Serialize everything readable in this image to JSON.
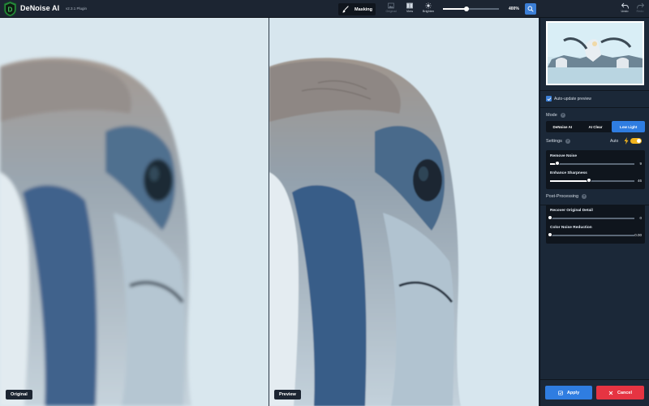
{
  "app": {
    "title": "DeNoise AI",
    "version": "v2.3.1 Plugin"
  },
  "toolbar": {
    "masking_label": "Masking",
    "tools": [
      {
        "label": "Original",
        "icon": "image-icon",
        "enabled": false
      },
      {
        "label": "View",
        "icon": "split-view-icon",
        "enabled": true
      },
      {
        "label": "Brighten",
        "icon": "sun-icon",
        "enabled": true
      }
    ],
    "zoom_value": "400%",
    "zoom_level": 0.4,
    "undo_label": "Undo",
    "redo_label": "Redo"
  },
  "panes": {
    "original_label": "Original",
    "preview_label": "Preview"
  },
  "sidebar": {
    "auto_update": {
      "label": "Auto-update preview",
      "checked": true
    },
    "mode": {
      "title": "Mode",
      "options": [
        "DeNoise AI",
        "AI Clear",
        "Low Light"
      ],
      "selected": "Low Light"
    },
    "settings": {
      "title": "Settings",
      "auto_label": "Auto",
      "auto_enabled": true,
      "sliders": [
        {
          "label": "Remove Noise",
          "value": "9",
          "fraction": 0.09
        },
        {
          "label": "Enhance Sharpness",
          "value": "46",
          "fraction": 0.46
        }
      ]
    },
    "post_processing": {
      "title": "Post-Processing",
      "sliders": [
        {
          "label": "Recover Original Detail",
          "value": "0",
          "fraction": 0
        },
        {
          "label": "Color Noise Reduction",
          "value": "0.00",
          "fraction": 0
        }
      ]
    },
    "apply_label": "Apply",
    "cancel_label": "Cancel"
  },
  "colors": {
    "accent": "#2f7de1",
    "danger": "#e63442",
    "toggle": "#f0b31e",
    "panel_bg": "#1b2838",
    "card_bg": "#0f151d"
  }
}
